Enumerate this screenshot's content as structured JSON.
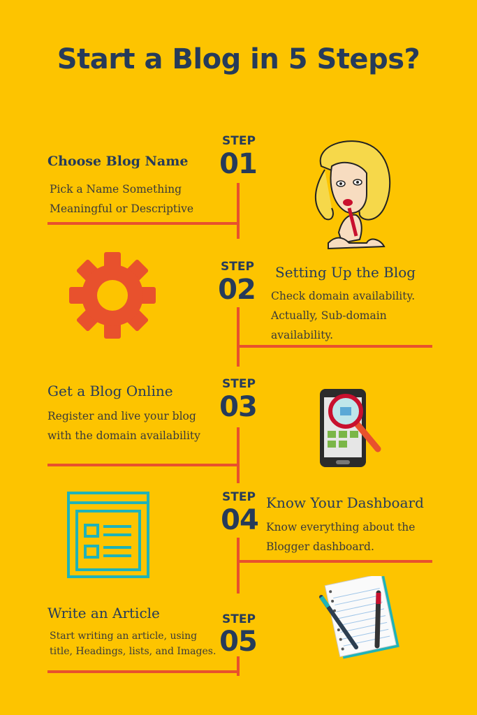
{
  "title": "Start a Blog in 5 Steps?",
  "colors": {
    "background": "#fdc400",
    "text_dark": "#263b5a",
    "accent": "#e8512d",
    "teal": "#1fb3b8"
  },
  "steps": [
    {
      "label": "STEP",
      "number": "01",
      "heading": "Choose Blog Name",
      "desc_lines": [
        "Pick a Name Something",
        "Meaningful or Descriptive"
      ],
      "icon": "woman-thinking-icon"
    },
    {
      "label": "STEP",
      "number": "02",
      "heading": "Setting Up the Blog",
      "desc_lines": [
        "Check domain availability.",
        "Actually, Sub-domain",
        "availability."
      ],
      "icon": "gear-icon"
    },
    {
      "label": "STEP",
      "number": "03",
      "heading": "Get a Blog Online",
      "desc_lines": [
        "Register and live your blog",
        "with the domain availability"
      ],
      "icon": "phone-search-icon"
    },
    {
      "label": "STEP",
      "number": "04",
      "heading": "Know Your Dashboard",
      "desc_lines": [
        "Know everything about the",
        "Blogger dashboard."
      ],
      "icon": "dashboard-layout-icon"
    },
    {
      "label": "STEP",
      "number": "05",
      "heading": "Write an Article",
      "desc_lines": [
        "Start writing an article, using",
        "title, Headings, lists, and Images."
      ],
      "icon": "notebook-pens-icon"
    }
  ]
}
